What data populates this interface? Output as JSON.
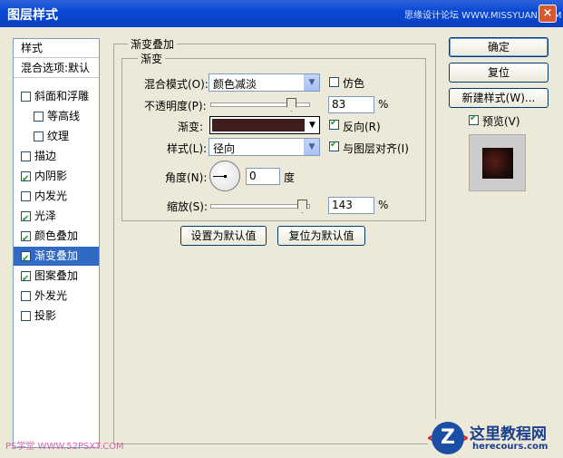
{
  "window": {
    "title": "图层样式",
    "watermark": "思缘设计论坛 WWW.MISSYUAN.COM",
    "close": "×"
  },
  "sidebar": {
    "header": "样式",
    "blend_options": "混合选项:默认",
    "items": [
      {
        "label": "斜面和浮雕",
        "checked": false
      },
      {
        "label": "等高线",
        "checked": false
      },
      {
        "label": "纹理",
        "checked": false
      },
      {
        "label": "描边",
        "checked": false
      },
      {
        "label": "内阴影",
        "checked": true
      },
      {
        "label": "内发光",
        "checked": false
      },
      {
        "label": "光泽",
        "checked": true
      },
      {
        "label": "颜色叠加",
        "checked": true
      },
      {
        "label": "渐变叠加",
        "checked": true,
        "selected": true
      },
      {
        "label": "图案叠加",
        "checked": true
      },
      {
        "label": "外发光",
        "checked": false
      },
      {
        "label": "投影",
        "checked": false
      }
    ]
  },
  "panel": {
    "outer_title": "渐变叠加",
    "inner_title": "渐变",
    "blend_mode_label": "混合模式(O):",
    "blend_mode_value": "颜色减淡",
    "dither_label": "仿色",
    "dither_checked": false,
    "opacity_label": "不透明度(P):",
    "opacity_value": "83",
    "opacity_unit": "%",
    "opacity_level": 0.83,
    "gradient_label": "渐变:",
    "gradient_color": "#3f1f1c",
    "reverse_label": "反向(R)",
    "reverse_checked": true,
    "style_label": "样式(L):",
    "style_value": "径向",
    "align_label": "与图层对齐(I)",
    "align_checked": true,
    "angle_label": "角度(N):",
    "angle_value": "0",
    "angle_unit": "度",
    "scale_label": "缩放(S):",
    "scale_value": "143",
    "scale_unit": "%",
    "scale_level": 0.95,
    "set_default": "设置为默认值",
    "reset_default": "复位为默认值"
  },
  "buttons": {
    "ok": "确定",
    "reset": "复位",
    "new_style": "新建样式(W)...",
    "preview_label": "预览(V)",
    "preview_checked": true
  },
  "branding": {
    "logo_line1": "这里教程网",
    "logo_line2": "herecours.com",
    "logo_letter": "Z",
    "footer": "PS学堂 WWW.52PSXT.COM"
  }
}
